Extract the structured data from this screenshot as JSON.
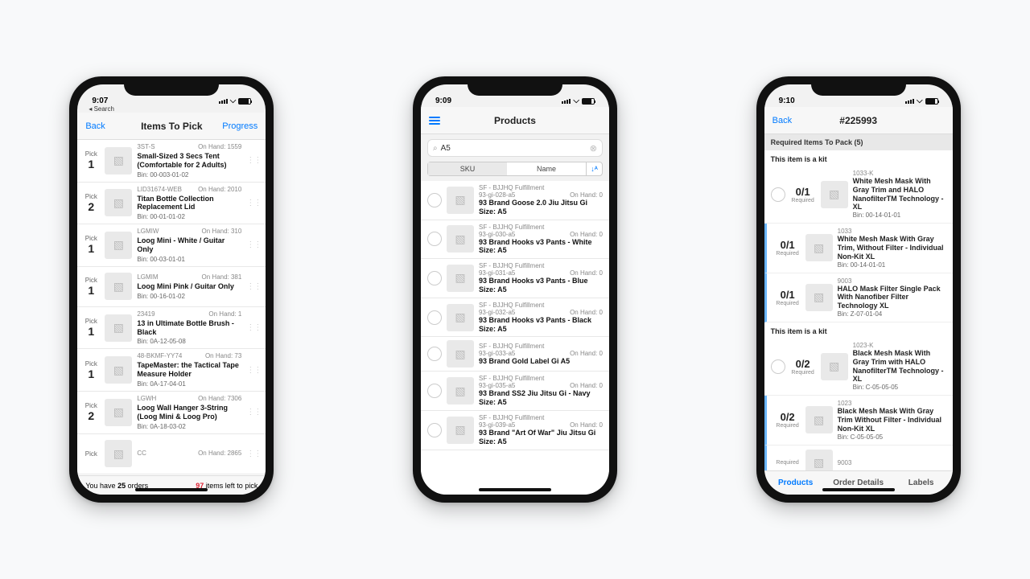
{
  "phone1": {
    "time": "9:07",
    "back_search_label": "◂ Search",
    "nav": {
      "back": "Back",
      "title": "Items To Pick",
      "progress": "Progress"
    },
    "pick_label": "Pick",
    "bin_label": "Bin:",
    "onhand_label": "On Hand:",
    "items": [
      {
        "pick": "1",
        "sku": "3ST-S",
        "onhand": "1559",
        "name": "Small-Sized 3 Secs Tent (Comfortable for 2 Adults)",
        "bin": "00-003-01-02"
      },
      {
        "pick": "2",
        "sku": "LID31674-WEB",
        "onhand": "2010",
        "name": "Titan Bottle Collection Replacement Lid",
        "bin": "00-01-01-02"
      },
      {
        "pick": "1",
        "sku": "LGMIW",
        "onhand": "310",
        "name": "Loog Mini - White / Guitar Only",
        "bin": "00-03-01-01"
      },
      {
        "pick": "1",
        "sku": "LGMIM",
        "onhand": "381",
        "name": "Loog Mini Pink / Guitar Only",
        "bin": "00-16-01-02"
      },
      {
        "pick": "1",
        "sku": "23419",
        "onhand": "1",
        "name": "13 in Ultimate Bottle Brush - Black",
        "bin": "0A-12-05-08"
      },
      {
        "pick": "1",
        "sku": "48-BKMF-YY74",
        "onhand": "73",
        "name": "TapeMaster: the Tactical Tape Measure Holder",
        "bin": "0A-17-04-01"
      },
      {
        "pick": "2",
        "sku": "LGWH",
        "onhand": "7306",
        "name": "Loog Wall Hanger 3-String (Loog Mini & Loog Pro)",
        "bin": "0A-18-03-02"
      },
      {
        "pick": "",
        "sku": "CC",
        "onhand": "2865",
        "name": "",
        "bin": ""
      }
    ],
    "footer": {
      "orders_pre": "You have",
      "orders_n": "25",
      "orders_post": "orders",
      "left_n": "97",
      "left_post": "items left to pick"
    }
  },
  "phone2": {
    "time": "9:09",
    "nav": {
      "title": "Products"
    },
    "search": {
      "query": "A5"
    },
    "seg": {
      "sku": "SKU",
      "name": "Name"
    },
    "vendor": "SF - BJJHQ Fulfillment",
    "onhand_label": "On Hand:",
    "items": [
      {
        "sku": "93-gi-028-a5",
        "onhand": "0",
        "name": "93 Brand Goose 2.0 Jiu Jitsu Gi  Size: A5"
      },
      {
        "sku": "93-gi-030-a5",
        "onhand": "0",
        "name": "93 Brand Hooks v3 Pants - White Size: A5"
      },
      {
        "sku": "93-gi-031-a5",
        "onhand": "0",
        "name": "93 Brand Hooks v3 Pants - Blue Size: A5"
      },
      {
        "sku": "93-gi-032-a5",
        "onhand": "0",
        "name": "93 Brand Hooks v3 Pants - Black Size: A5"
      },
      {
        "sku": "93-gi-033-a5",
        "onhand": "0",
        "name": "93 Brand Gold Label Gi A5"
      },
      {
        "sku": "93-gi-035-a5",
        "onhand": "0",
        "name": "93 Brand SS2 Jiu Jitsu Gi - Navy Size: A5"
      },
      {
        "sku": "93-gi-039-a5",
        "onhand": "0",
        "name": "93 Brand \"Art Of War\" Jiu Jitsu Gi Size: A5"
      }
    ]
  },
  "phone3": {
    "time": "9:10",
    "nav": {
      "back": "Back",
      "title": "#225993"
    },
    "section": "Required Items To Pack (5)",
    "kit_header": "This item is a kit",
    "bin_label": "Bin:",
    "required_label": "Required",
    "kits": [
      {
        "sku": "1033-K",
        "name": "White Mesh Mask With Gray Trim and HALO NanofilterTM Technology - XL",
        "ratio": "0/1",
        "bin": "00-14-01-01",
        "is_parent": true
      },
      {
        "sku": "1033",
        "name": "White Mesh Mask With Gray Trim, Without Filter - Individual Non-Kit XL",
        "ratio": "0/1",
        "bin": "00-14-01-01",
        "is_parent": false
      },
      {
        "sku": "9003",
        "name": "HALO Mask Filter Single Pack With Nanofiber Filter Technology XL",
        "ratio": "0/1",
        "bin": "Z-07-01-04",
        "is_parent": false
      }
    ],
    "kits2": [
      {
        "sku": "1023-K",
        "name": "Black Mesh Mask With Gray Trim with HALO NanofilterTM Technology - XL",
        "ratio": "0/2",
        "bin": "C-05-05-05",
        "is_parent": true
      },
      {
        "sku": "1023",
        "name": "Black Mesh Mask With Gray Trim Without Filter - Individual Non-Kit XL",
        "ratio": "0/2",
        "bin": "C-05-05-05",
        "is_parent": false
      },
      {
        "sku": "9003",
        "name": "",
        "ratio": "",
        "bin": "",
        "is_parent": false
      }
    ],
    "tabs": {
      "products": "Products",
      "details": "Order Details",
      "labels": "Labels"
    }
  }
}
